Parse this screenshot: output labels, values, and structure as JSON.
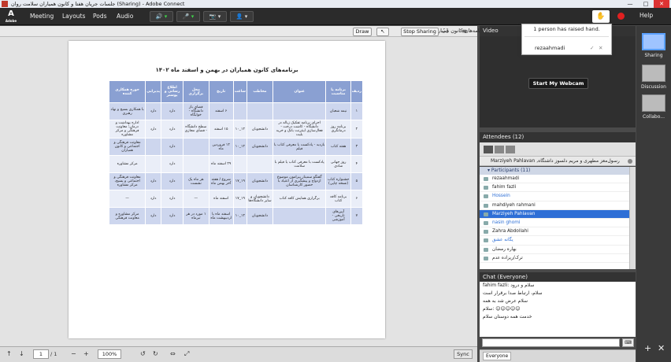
{
  "window": {
    "title": "جلسات جریان هفتا و کانون همیاران سلامت روان (Sharing) - Adobe Connect",
    "min": "—",
    "max": "□",
    "close": "✕"
  },
  "app": {
    "logo": "A",
    "logo_sub": "Adobe"
  },
  "menu": [
    "Meeting",
    "Layouts",
    "Pods",
    "Audio"
  ],
  "toolbar": {
    "speaker": "🔊",
    "mic": "🎤",
    "cam": "📷",
    "person": "👤",
    "raise_hand": "✋",
    "help": "Help"
  },
  "share": {
    "title": "بهمن و اسفند 1402 برنامه‌های کانون همیاران.pdf",
    "draw": "Draw",
    "stop": "Stop Sharing",
    "fullscreen": "⛶"
  },
  "doc": {
    "title": "برنامه‌های کانون همیاران در بهمن و اسفند ماه ۱۴۰۲",
    "headers": [
      "ردیف",
      "برنامه یا مناسبت",
      "عنوان",
      "مخاطب",
      "ساعت",
      "تاریخ",
      "محل برگزاری",
      "اطلاع رسانی و پوستر",
      "پذیرایی",
      "حوزه همکاری کننده"
    ],
    "rows": [
      [
        "۱",
        "نیمه شعبان",
        "",
        "",
        "",
        "۶ اسفند",
        "فضای باز دانشگاه - خوابگاه",
        "دارد",
        "دارد",
        "با همکاری بسیج و نهاد رهبری"
      ],
      [
        "۲",
        "برنامه روز درمانگری",
        "اجرای برنامه تفکیک زباله در دانشگاه - کاشت درخت - فعال‌سازی اینترنت بانک و خرید بلیت",
        "دانشجویان",
        "۱۲_۱۰",
        "۱۵ اسفند",
        "سطح دانشگاه - فضای مجازی",
        "دارد",
        "دارد",
        "اداره بهداشت و درمان؛ معاونت فرهنگی و مرکز مشاوره"
      ],
      [
        "۳",
        "هفته کتاب",
        "بازدید - پادکست با معرفی کتاب با فیلم",
        "دانشجویان",
        "۱۲_۱۰",
        "۱۲ فروردین ماه",
        "",
        "دارد",
        "",
        "معاونت فرهنگی و اجتماعی و کانون همیاران"
      ],
      [
        "۴",
        "روز جهانی شادی",
        "پادکست با معرفی کتاب یا فیلم با سلامت",
        "",
        "",
        "۲۹ اسفند ماه",
        "",
        "دارد",
        "",
        "مرکز مشاوره"
      ],
      [
        "۵",
        "جشنواره کتاب (نسخه چاپی)",
        "گفتگو سمینار پیرامون موضوع ازدواج و پیشگیری از اعتیاد با حضور کارشناسان",
        "دانشجویان",
        "۱۹_۱۷",
        "شروع / هفته آخر بهمن ماه",
        "هر ماه یک نشست",
        "دارد",
        "دارد",
        "معاونت فرهنگی و اجتماعی و بسیج، مرکز مشاوره"
      ],
      [
        "۶",
        "برنامه کافه کتاب",
        "برگزاری همایش کافه کتاب",
        "دانشجویان و سایر دانشگاه‌ها",
        "۱۹_۱۷",
        "اسفند ماه",
        "—",
        "دارد",
        "دارد",
        "—"
      ],
      [
        "۷",
        "آیین‌های تاریخی - آموزشی",
        "",
        "دانشجویان",
        "۱۲_۱۰",
        "اسفند ماه یا اردیبهشت ماه",
        "۱ مورد در هر تیرماه",
        "دارد",
        "دارد",
        "مرکز مشاوره و معاونت فرهنگی"
      ]
    ]
  },
  "bottom": {
    "page": "1",
    "total": "/ 1",
    "zoom": "100%",
    "sync": "Sync"
  },
  "video": {
    "title": "Video",
    "webcam": "Start My Webcam"
  },
  "notification": {
    "message": "1 person has raised hand.",
    "name": "rezaahmadi"
  },
  "attendees": {
    "title": "Attendees  (12)",
    "presenter": "Marziyeh Pahlavan ,رسول‌معز مطهری و مریم دلسوز داشتگاه",
    "participants_label": "▾ Participants (11)",
    "list": [
      {
        "name": "rezaahmadi",
        "cls": ""
      },
      {
        "name": "fahim fazli",
        "cls": ""
      },
      {
        "name": "Hossein",
        "cls": "blue"
      },
      {
        "name": "mahdiyeh rahmani",
        "cls": ""
      },
      {
        "name": "Marziyeh Pahlavan",
        "cls": "sel"
      },
      {
        "name": "nasin ghomi",
        "cls": "blue"
      },
      {
        "name": "Zahra Abdollahi",
        "cls": ""
      },
      {
        "name": "یگانه عشق",
        "cls": "blue"
      },
      {
        "name": "بهاره رمضان",
        "cls": ""
      },
      {
        "name": "ترک/ریزاده عدم",
        "cls": ""
      }
    ]
  },
  "chat": {
    "title": "Chat  (Everyone)",
    "lines": [
      "fahim fazli: سلام و درود",
      "سلام، ارتباط صدا برقرار است",
      "سلام عرض شد به همه",
      "سلام: ☺☺☺☺☺",
      "خدمت همه دوستان سلام"
    ],
    "send": "⌨",
    "tab": "Everyone"
  },
  "layouts": [
    {
      "label": "Sharing",
      "active": true
    },
    {
      "label": "Discussion",
      "active": false
    },
    {
      "label": "Collabo...",
      "active": false
    }
  ]
}
